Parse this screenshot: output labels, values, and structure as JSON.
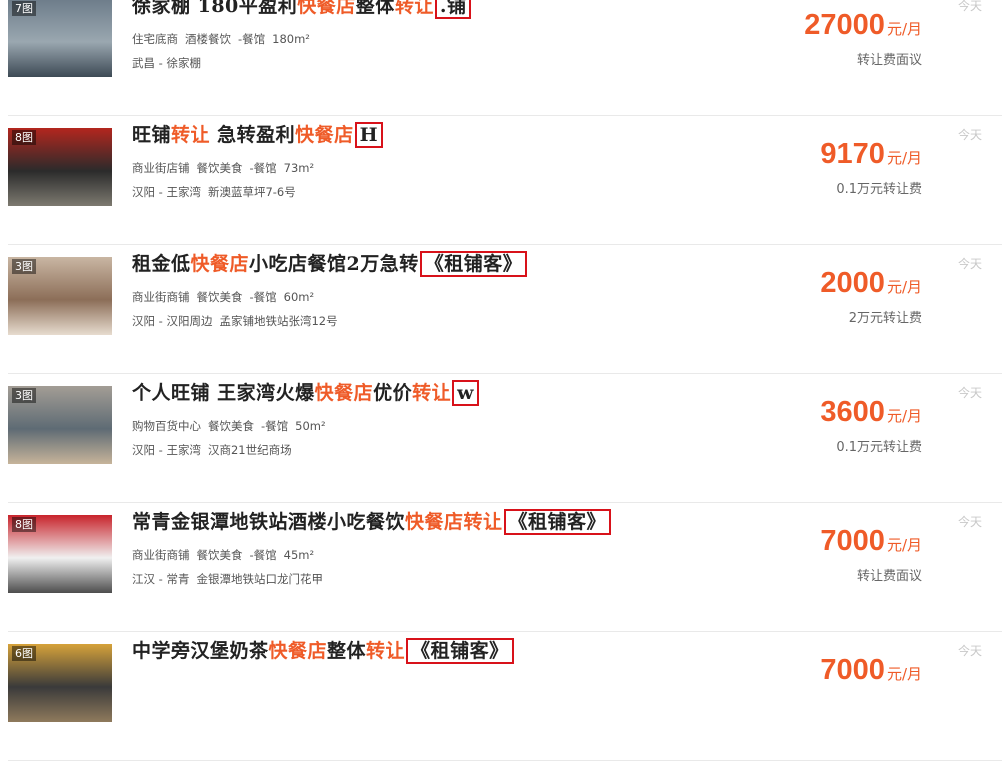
{
  "listings": [
    {
      "photo_count": "7图",
      "title_parts": [
        {
          "text": "徐家棚 180平盈利",
          "hl": false
        },
        {
          "text": "快餐店",
          "hl": true
        },
        {
          "text": "整体",
          "hl": false
        },
        {
          "text": "转让",
          "hl": true
        }
      ],
      "title_suffix": ".铺",
      "tags": [
        "住宅底商",
        "酒楼餐饮",
        "-餐馆",
        "180m²"
      ],
      "district": "武昌",
      "area": "徐家棚",
      "address": "",
      "price": "27000",
      "unit": "元/月",
      "fee": "转让费面议",
      "date": "今天",
      "thumb_colors": [
        "#6d7c8a",
        "#9aa7b0",
        "#3d4a55"
      ]
    },
    {
      "photo_count": "8图",
      "title_parts": [
        {
          "text": "旺铺",
          "hl": false
        },
        {
          "text": "转让",
          "hl": true
        },
        {
          "text": " 急转盈利",
          "hl": false
        },
        {
          "text": "快餐店",
          "hl": true
        }
      ],
      "title_suffix": "H",
      "tags": [
        "商业街店铺",
        "餐饮美食",
        "-餐馆",
        "73m²"
      ],
      "district": "汉阳",
      "area": "王家湾",
      "address": "新澳蓝草坪7-6号",
      "price": "9170",
      "unit": "元/月",
      "fee": "0.1万元转让费",
      "date": "今天",
      "thumb_colors": [
        "#b3261e",
        "#2b2b2b",
        "#7d7a70"
      ]
    },
    {
      "photo_count": "3图",
      "title_parts": [
        {
          "text": "租金低",
          "hl": false
        },
        {
          "text": "快餐店",
          "hl": true
        },
        {
          "text": "小吃店餐馆2万急转",
          "hl": false
        }
      ],
      "title_suffix": "《租铺客》",
      "tags": [
        "商业街商铺",
        "餐饮美食",
        "-餐馆",
        "60m²"
      ],
      "district": "汉阳",
      "area": "汉阳周边",
      "address": "孟家铺地铁站张湾12号",
      "price": "2000",
      "unit": "元/月",
      "fee": "2万元转让费",
      "date": "今天",
      "thumb_colors": [
        "#c9b6a3",
        "#8c6e58",
        "#e7dccf"
      ]
    },
    {
      "photo_count": "3图",
      "title_parts": [
        {
          "text": "个人旺铺 王家湾火爆",
          "hl": false
        },
        {
          "text": "快餐店",
          "hl": true
        },
        {
          "text": "优价",
          "hl": false
        },
        {
          "text": "转让",
          "hl": true
        }
      ],
      "title_suffix": "w",
      "tags": [
        "购物百货中心",
        "餐饮美食",
        "-餐馆",
        "50m²"
      ],
      "district": "汉阳",
      "area": "王家湾",
      "address": "汉商21世纪商场",
      "price": "3600",
      "unit": "元/月",
      "fee": "0.1万元转让费",
      "date": "今天",
      "thumb_colors": [
        "#a39d95",
        "#5e6b74",
        "#c7b49a"
      ]
    },
    {
      "photo_count": "8图",
      "title_parts": [
        {
          "text": "常青金银潭地铁站酒楼小吃餐饮",
          "hl": false
        },
        {
          "text": "快餐店",
          "hl": true
        },
        {
          "text": "转让",
          "hl": true
        }
      ],
      "title_suffix": "《租铺客》",
      "tags": [
        "商业街商铺",
        "餐饮美食",
        "-餐馆",
        "45m²"
      ],
      "district": "江汉",
      "area": "常青",
      "address": "金银潭地铁站口龙门花甲",
      "price": "7000",
      "unit": "元/月",
      "fee": "转让费面议",
      "date": "今天",
      "thumb_colors": [
        "#c8232b",
        "#f0f0f0",
        "#4d4d4d"
      ]
    },
    {
      "photo_count": "6图",
      "title_parts": [
        {
          "text": "中学旁汉堡奶茶",
          "hl": false
        },
        {
          "text": "快餐店",
          "hl": true
        },
        {
          "text": "整体",
          "hl": false
        },
        {
          "text": "转让",
          "hl": true
        }
      ],
      "title_suffix": "《租铺客》",
      "tags": [],
      "district": "",
      "area": "",
      "address": "",
      "price": "7000",
      "unit": "元/月",
      "fee": "",
      "date": "今天",
      "thumb_colors": [
        "#d6a23a",
        "#3a3a3a",
        "#8f7a5c"
      ]
    }
  ]
}
